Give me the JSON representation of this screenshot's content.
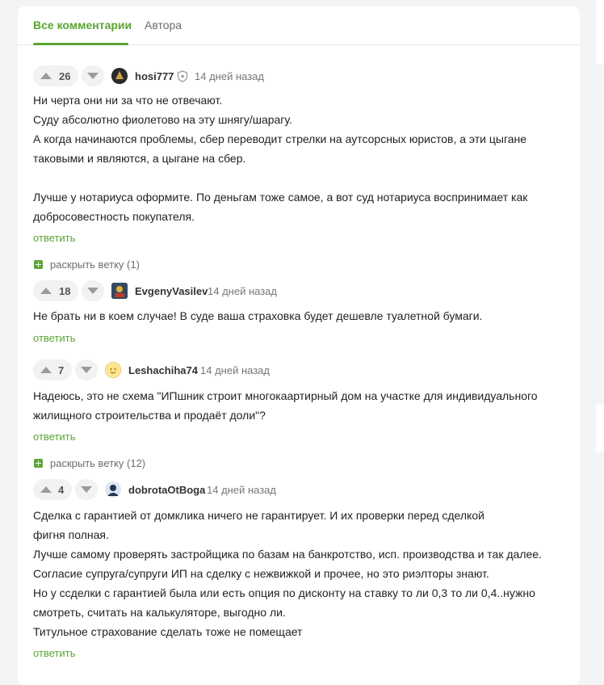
{
  "tabs": [
    {
      "label": "Все комментарии",
      "active": true
    },
    {
      "label": "Автора",
      "active": false
    }
  ],
  "comments": [
    {
      "votes": "26",
      "author": "hosi777",
      "time": "14 дней назад",
      "lines": [
        "Ни черта они ни за что не отвечают.",
        "Суду абсолютно фиолетово на эту шнягу/шарагу.",
        "А когда начинаются проблемы, сбер переводит стрелки на аутсорсных юристов, а эти цыгане",
        "таковыми и являются, а цыгане на сбер.",
        "",
        "Лучше у нотариуса оформите. По деньгам тоже самое, а вот суд нотариуса воспринимает как",
        "добросовестность покупателя."
      ],
      "reply_label": "ответить"
    },
    {
      "votes": "18",
      "author": "EvgenyVasilev",
      "time": "14 дней назад",
      "lines": [
        "Не брать ни в коем случае! В суде ваша страховка будет дешевле туалетной бумаги."
      ],
      "reply_label": "ответить"
    },
    {
      "votes": "7",
      "author": "Leshachiha74",
      "time": "14 дней назад",
      "lines": [
        "Надеюсь, это не схема \"ИПшник строит многокаартирный дом на участке для индивидуального",
        "жилищного строительства и продаёт доли\"?"
      ],
      "reply_label": "ответить"
    },
    {
      "votes": "4",
      "author": "dobrotaOtBoga",
      "time": "14 дней назад",
      "lines": [
        "Сделка с гарантией от домклика ничего не гарантирует. И их проверки перед сделкой",
        "фигня полная.",
        "Лучше самому проверять застройщика по базам на банкротство, исп. производства и так далее.",
        "Согласие супруга/супруги ИП на сделку с нежвижкой и прочее, но это риэлторы знают.",
        "Но у ссделки с гарантией была или есть опция по дисконту на ставку то ли 0,3 то ли 0,4..нужно",
        "смотреть, считать на калькуляторе, выгодно ли.",
        "Титульное страхование сделать тоже не помещает"
      ],
      "reply_label": "ответить"
    }
  ],
  "expand_threads": [
    {
      "label": "раскрыть ветку (1)"
    },
    {
      "label": "раскрыть ветку (12)"
    }
  ],
  "colors": {
    "accent": "#5aa533",
    "text": "#222222",
    "muted": "#777777"
  }
}
